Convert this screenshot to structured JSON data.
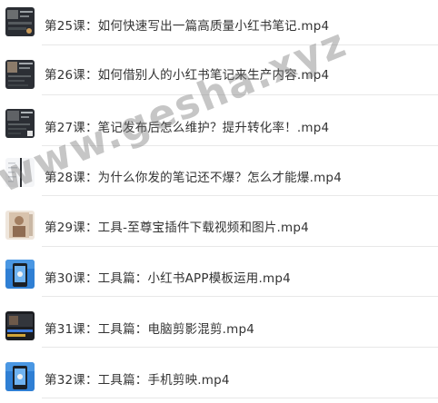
{
  "files": [
    {
      "name": "第25课：如何快速写出一篇高质量小红书笔记.mp4",
      "thumb": "dark-photo"
    },
    {
      "name": "第26课：如何借别人的小红书笔记来生产内容.mp4",
      "thumb": "dark-photo"
    },
    {
      "name": "第27课：笔记发布后怎么维护？提升转化率！.mp4",
      "thumb": "dark-photo"
    },
    {
      "name": "第28课：为什么你发的笔记还不爆？怎么才能爆.mp4",
      "thumb": "light-screen"
    },
    {
      "name": "第29课：工具-至尊宝插件下载视频和图片.mp4",
      "thumb": "warm-photo"
    },
    {
      "name": "第30课：工具篇：小红书APP模板运用.mp4",
      "thumb": "blue-phone"
    },
    {
      "name": "第31课：工具篇：电脑剪影混剪.mp4",
      "thumb": "dark-editor"
    },
    {
      "name": "第32课：工具篇：手机剪映.mp4",
      "thumb": "blue-phone"
    }
  ],
  "watermark": "www.gesha.xyz",
  "colors": {
    "text": "#333333",
    "divider": "#e8e8e8",
    "watermark": "rgba(120,120,120,0.42)"
  }
}
